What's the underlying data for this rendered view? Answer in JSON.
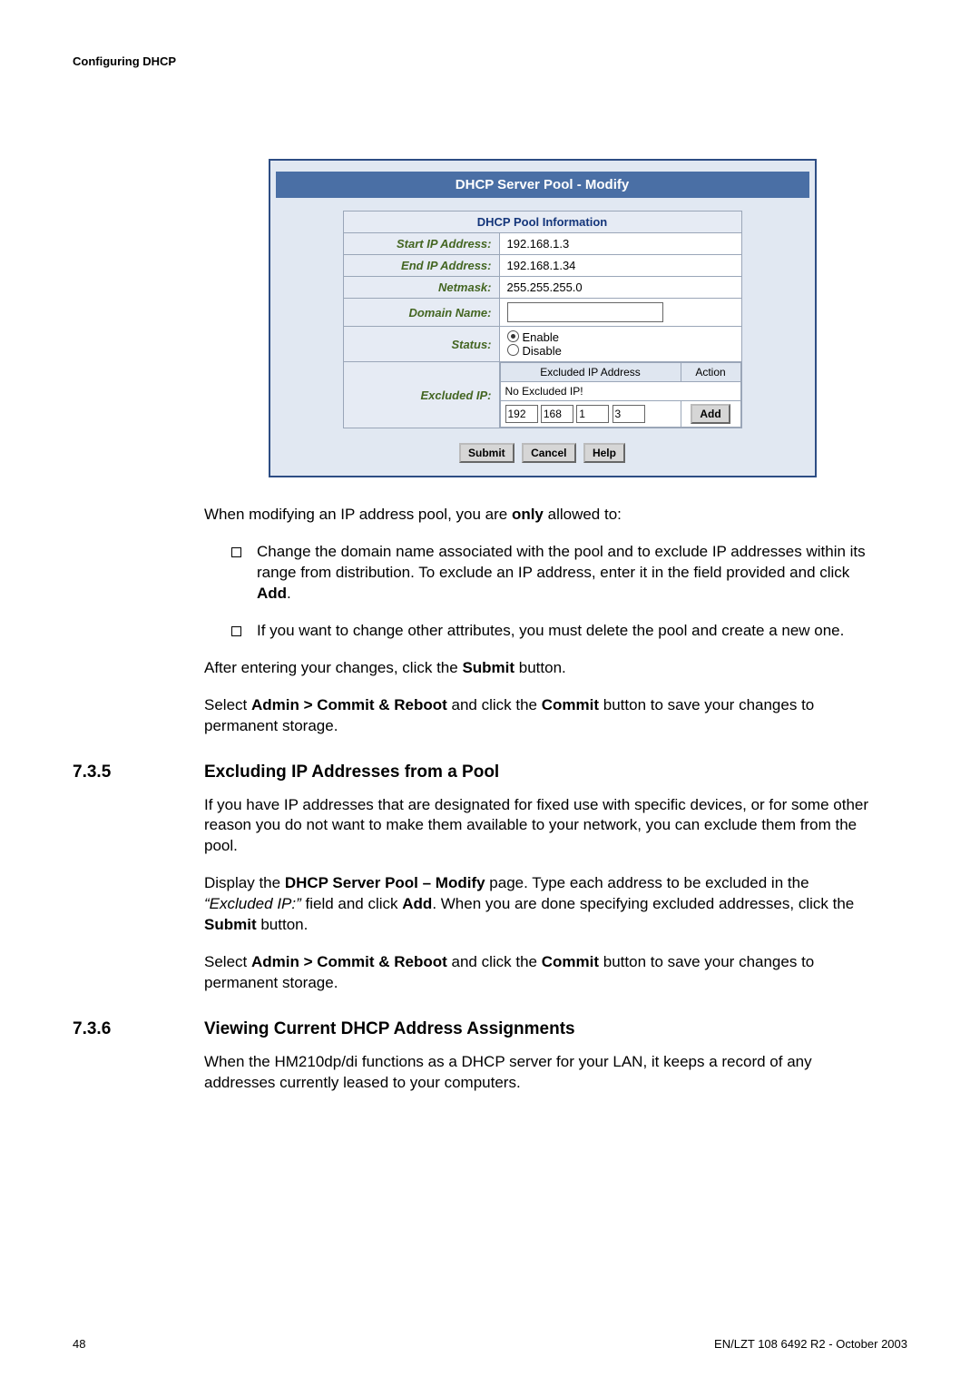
{
  "running_head": "Configuring DHCP",
  "screenshot": {
    "title": "DHCP Server Pool - Modify",
    "section": "DHCP Pool Information",
    "rows": {
      "start_ip": {
        "label": "Start IP Address:",
        "value": "192.168.1.3"
      },
      "end_ip": {
        "label": "End IP Address:",
        "value": "192.168.1.34"
      },
      "netmask": {
        "label": "Netmask:",
        "value": "255.255.255.0"
      },
      "domain": {
        "label": "Domain Name:",
        "value": ""
      },
      "status": {
        "label": "Status:",
        "opt_enable": "Enable",
        "opt_disable": "Disable",
        "selected": "Enable"
      },
      "excluded": {
        "label": "Excluded IP:",
        "col_addr": "Excluded IP Address",
        "col_action": "Action",
        "none_row": "No Excluded IP!",
        "octets": [
          "192",
          "168",
          "1",
          "3"
        ],
        "add_btn": "Add"
      }
    },
    "buttons": {
      "submit": "Submit",
      "cancel": "Cancel",
      "help": "Help"
    }
  },
  "para_intro_before_bold": "When modifying an IP address pool, you are ",
  "para_intro_bold": "only",
  "para_intro_after_bold": " allowed to:",
  "bullets": [
    {
      "pre": "Change the domain name associated with the pool and to exclude IP addresses within its range from distribution. To exclude an IP address, enter it in the field provided and click ",
      "bold": "Add",
      "post": "."
    },
    {
      "pre": "If you want to change other attributes, you must delete the pool and create a new one.",
      "bold": "",
      "post": ""
    }
  ],
  "para_after1_pre": "After entering your changes, click the ",
  "para_after1_bold": "Submit",
  "para_after1_post": " button.",
  "para_commit1_a": "Select ",
  "para_commit1_b": "Admin > Commit & Reboot",
  "para_commit1_c": " and click the ",
  "para_commit1_d": "Commit",
  "para_commit1_e": " button to save your changes to permanent storage.",
  "sec735_num": "7.3.5",
  "sec735_title": "Excluding IP Addresses from a Pool",
  "sec735_p1": "If you have IP addresses that are designated for fixed use with specific devices, or for some other reason you do not want to make them available to your network, you can exclude them from the pool.",
  "sec735_p2_a": "Display the ",
  "sec735_p2_b": "DHCP Server Pool – Modify",
  "sec735_p2_c": " page. Type each address to be excluded in the ",
  "sec735_p2_d": "“Excluded IP:”",
  "sec735_p2_e": " field and click ",
  "sec735_p2_f": "Add",
  "sec735_p2_g": ". When you are done specifying excluded addresses, click the ",
  "sec735_p2_h": "Submit",
  "sec735_p2_i": " button.",
  "sec735_p3_a": "Select ",
  "sec735_p3_b": "Admin > Commit & Reboot",
  "sec735_p3_c": " and click the ",
  "sec735_p3_d": "Commit",
  "sec735_p3_e": " button to save your changes to permanent storage.",
  "sec736_num": "7.3.6",
  "sec736_title": "Viewing Current DHCP Address Assignments",
  "sec736_p1": "When the HM210dp/di functions as a DHCP server for your LAN, it keeps a record of any addresses currently leased to your computers.",
  "footer_left": "48",
  "footer_right": "EN/LZT 108 6492 R2  - October 2003"
}
